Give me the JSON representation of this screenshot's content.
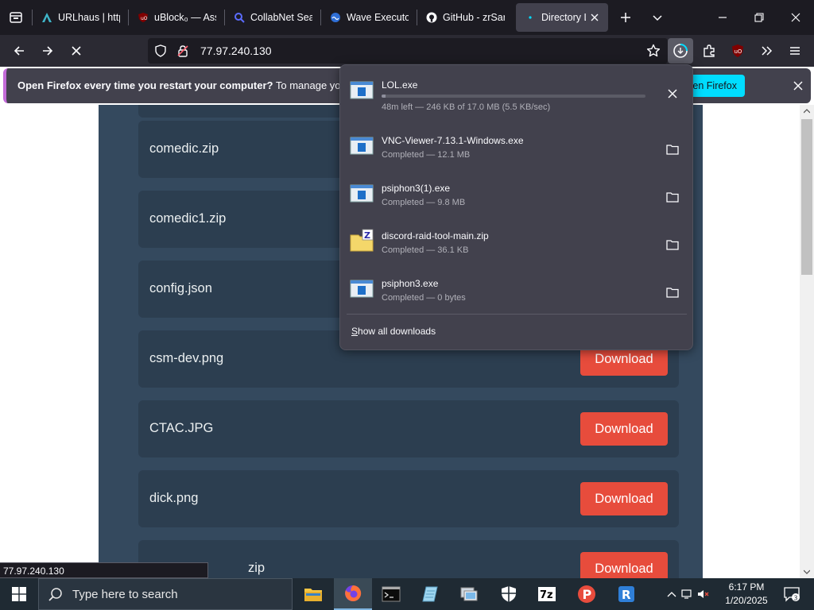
{
  "browser": {
    "tabs": [
      {
        "title": "URLhaus | http",
        "icon": "urlhaus-icon",
        "active": false
      },
      {
        "title": "uBlock₀ — Ass",
        "icon": "ublock-icon",
        "active": false
      },
      {
        "title": "CollabNet Sea",
        "icon": "search-icon",
        "active": false
      },
      {
        "title": "Wave Executo",
        "icon": "wave-icon",
        "active": false
      },
      {
        "title": "GitHub - zrSar",
        "icon": "github-icon",
        "active": false
      },
      {
        "title": "Directory Li",
        "icon": "loading-dot-icon",
        "active": true
      }
    ],
    "url": "77.97.240.130",
    "notification": {
      "bold": "Open Firefox every time you restart your computer?",
      "text": " To manage your Start",
      "action_label": "en Firefox"
    }
  },
  "page": {
    "files": [
      {
        "name": "comedic.zip",
        "button": ""
      },
      {
        "name": "comedic1.zip",
        "button": ""
      },
      {
        "name": "config.json",
        "button": ""
      },
      {
        "name": "csm-dev.png",
        "button": "Download"
      },
      {
        "name": "CTAC.JPG",
        "button": "Download"
      },
      {
        "name": "dick.png",
        "button": "Download"
      },
      {
        "name": "zip",
        "button": "Download"
      }
    ],
    "colors": {
      "container": "#34495e",
      "row": "#2c3e50",
      "button": "#e74c3c"
    }
  },
  "downloads": {
    "items": [
      {
        "name": "LOL.exe",
        "status": "48m left — 246 KB of 17.0 MB (5.5 KB/sec)",
        "icon": "exe-file-icon",
        "action": "cancel",
        "progress": 0.014
      },
      {
        "name": "VNC-Viewer-7.13.1-Windows.exe",
        "status": "Completed — 12.1 MB",
        "icon": "exe-file-icon",
        "action": "folder"
      },
      {
        "name": "psiphon3(1).exe",
        "status": "Completed — 9.8 MB",
        "icon": "exe-file-icon",
        "action": "folder"
      },
      {
        "name": "discord-raid-tool-main.zip",
        "status": "Completed — 36.1 KB",
        "icon": "zip-file-icon",
        "action": "folder"
      },
      {
        "name": "psiphon3.exe",
        "status": "Completed — 0 bytes",
        "icon": "exe-file-icon",
        "action": "folder"
      }
    ],
    "show_all": "Show all downloads"
  },
  "status_bar": {
    "url": "77.97.240.130"
  },
  "taskbar": {
    "search_placeholder": "Type here to search",
    "time": "6:17 PM",
    "date": "1/20/2025",
    "notification_count": "3"
  }
}
